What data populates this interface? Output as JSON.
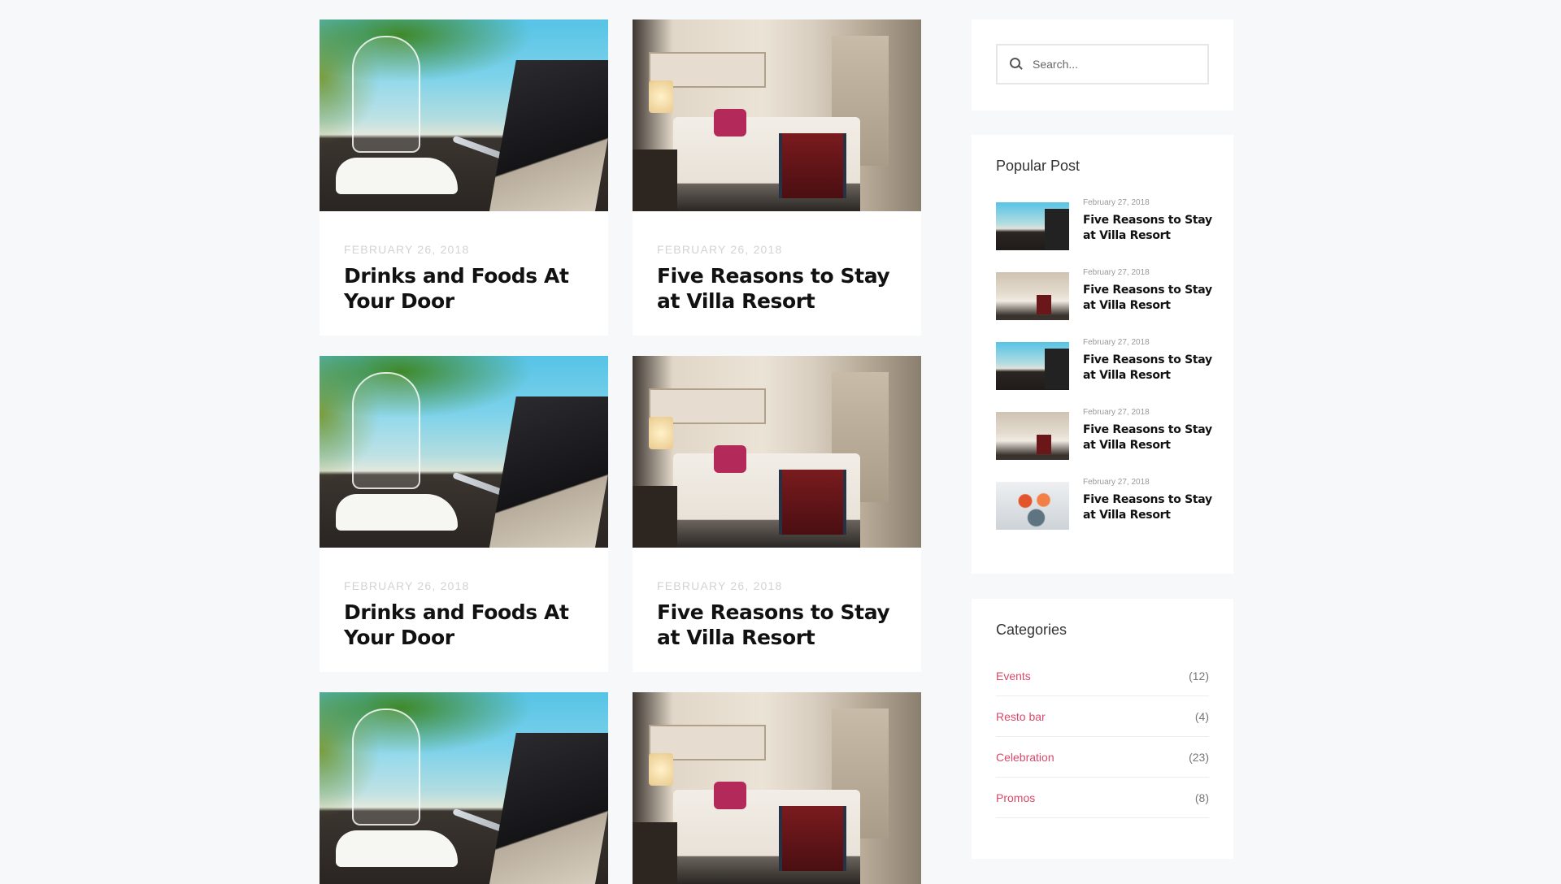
{
  "posts": [
    {
      "date": "FEBRUARY 26, 2018",
      "title": "Drinks and Foods At Your Door",
      "image": "table-setting-beach"
    },
    {
      "date": "FEBRUARY 26, 2018",
      "title": "Five Reasons to Stay at Villa Resort",
      "image": "hotel-bedroom"
    },
    {
      "date": "FEBRUARY 26, 2018",
      "title": "Drinks and Foods At Your Door",
      "image": "table-setting-beach"
    },
    {
      "date": "FEBRUARY 26, 2018",
      "title": "Five Reasons to Stay at Villa Resort",
      "image": "hotel-bedroom"
    },
    {
      "image": "table-setting-beach"
    },
    {
      "image": "hotel-bedroom"
    }
  ],
  "search": {
    "placeholder": "Search..."
  },
  "popular": {
    "title": "Popular Post",
    "items": [
      {
        "date": "February 27, 2018",
        "title": "Five Reasons to Stay at Villa Resort",
        "thumb": "beach"
      },
      {
        "date": "February 27, 2018",
        "title": "Five Reasons to Stay at Villa Resort",
        "thumb": "room"
      },
      {
        "date": "February 27, 2018",
        "title": "Five Reasons to Stay at Villa Resort",
        "thumb": "beach"
      },
      {
        "date": "February 27, 2018",
        "title": "Five Reasons to Stay at Villa Resort",
        "thumb": "room"
      },
      {
        "date": "February 27, 2018",
        "title": "Five Reasons to Stay at Villa Resort",
        "thumb": "crab"
      }
    ]
  },
  "categories": {
    "title": "Categories",
    "items": [
      {
        "name": "Events",
        "count": "(12)"
      },
      {
        "name": "Resto bar",
        "count": "(4)"
      },
      {
        "name": "Celebration",
        "count": "(23)"
      },
      {
        "name": "Promos",
        "count": "(8)"
      }
    ]
  },
  "colors": {
    "accent": "#d9486a",
    "background": "#f7f8fa"
  }
}
